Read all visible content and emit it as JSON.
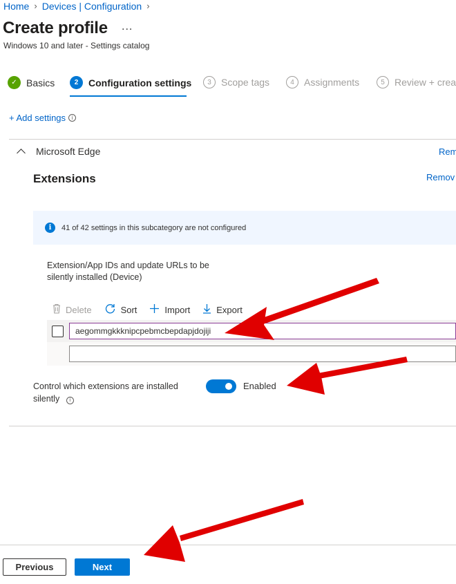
{
  "breadcrumb": {
    "items": [
      "Home",
      "Devices | Configuration"
    ]
  },
  "page": {
    "title": "Create profile",
    "more": "...",
    "subtitle": "Windows 10 and later - Settings catalog"
  },
  "wizard": {
    "steps": [
      {
        "number": "✓",
        "label": "Basics",
        "state": "done"
      },
      {
        "number": "2",
        "label": "Configuration settings",
        "state": "active"
      },
      {
        "number": "3",
        "label": "Scope tags",
        "state": "pending"
      },
      {
        "number": "4",
        "label": "Assignments",
        "state": "pending"
      },
      {
        "number": "5",
        "label": "Review + creat",
        "state": "pending"
      }
    ]
  },
  "add_settings": {
    "label": "+ Add settings",
    "info_icon": "i"
  },
  "category": {
    "name": "Microsoft Edge",
    "remove_link": "Rem",
    "subcategory": {
      "title": "Extensions",
      "remove_link": "Remov",
      "info_banner": {
        "icon": "i",
        "text": "41 of 42 settings in this subcategory are not configured"
      },
      "setting": {
        "label": "Extension/App IDs and update URLs to be silently installed (Device)",
        "toolbar": {
          "delete": "Delete",
          "sort": "Sort",
          "import": "Import",
          "export": "Export"
        },
        "values": [
          "aegommgkkknipcpebmcbepdapjdojiji",
          ""
        ]
      },
      "control": {
        "label": "Control which extensions are installed silently",
        "info_icon": "i",
        "toggle_state": "Enabled"
      }
    }
  },
  "footer": {
    "previous": "Previous",
    "next": "Next"
  },
  "colors": {
    "accent": "#0078d4",
    "link": "#0064c8",
    "success": "#57a300",
    "annotation_arrow": "#e00000",
    "banner_bg": "#f0f6ff"
  },
  "annotations": {
    "arrow_count": 3,
    "arrow_color": "#e00000"
  }
}
